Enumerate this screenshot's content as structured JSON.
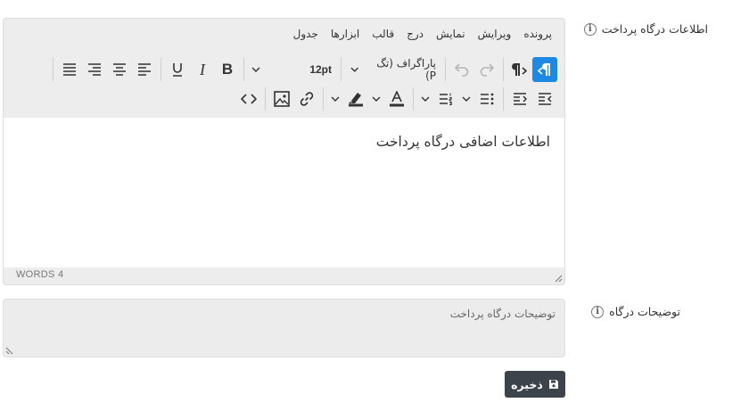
{
  "fields": {
    "gateway_info_label": "اطلاعات درگاه پرداخت",
    "gateway_desc_label": "توضیحات درگاه",
    "info_icon_glyph": "i"
  },
  "editor": {
    "menubar": [
      "پرونده",
      "ویرایش",
      "نمایش",
      "درج",
      "قالب",
      "ابزارها",
      "جدول"
    ],
    "format_select": "پاراگراف (تگ P)",
    "font_size": "12pt",
    "content": "اطلاعات اضافی درگاه پرداخت",
    "word_count": "WORDS 4"
  },
  "description": {
    "placeholder": "توضیحات درگاه پرداخت"
  },
  "save_button": {
    "label": "ذخیره"
  },
  "colors": {
    "accent": "#1e88e5",
    "button_dark": "#3d434a",
    "editor_bg": "#ededed"
  },
  "icons": [
    "ltr-paragraph-icon",
    "rtl-paragraph-icon",
    "redo-icon",
    "undo-icon",
    "chevron-down-icon",
    "bold-icon",
    "italic-icon",
    "underline-icon",
    "align-left-icon",
    "align-center-icon",
    "align-right-icon",
    "align-justify-icon",
    "indent-icon",
    "outdent-icon",
    "bullet-list-icon",
    "numbered-list-icon",
    "text-color-icon",
    "highlight-icon",
    "link-icon",
    "image-icon",
    "code-icon",
    "save-icon",
    "info-icon"
  ]
}
